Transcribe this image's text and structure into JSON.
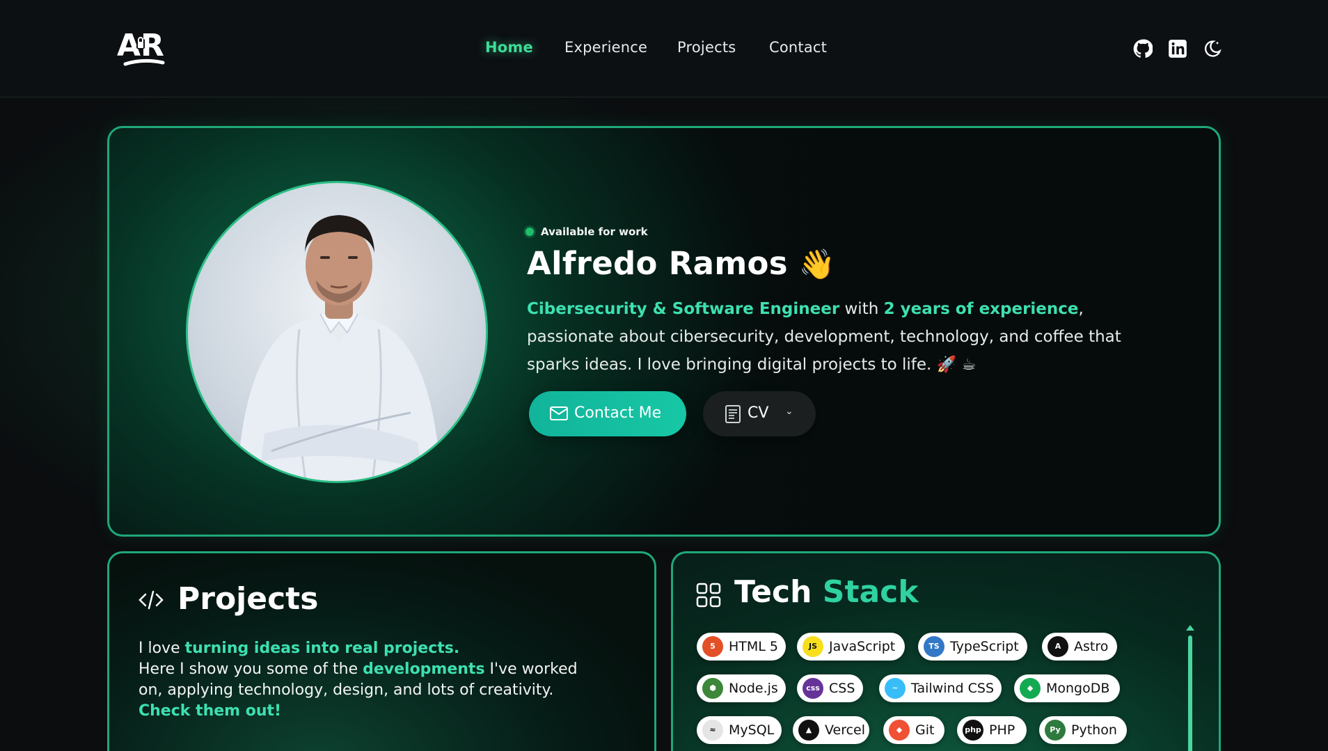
{
  "brand": {
    "logo_text": "AR"
  },
  "nav": {
    "items": [
      {
        "label": "Home",
        "active": true
      },
      {
        "label": "Experience",
        "active": false
      },
      {
        "label": "Projects",
        "active": false
      },
      {
        "label": "Contact",
        "active": false
      }
    ]
  },
  "header_icons": [
    "github-icon",
    "linkedin-icon",
    "theme-toggle-icon"
  ],
  "hero": {
    "status": "Available for work",
    "name": "Alfredo Ramos",
    "name_emoji": "👋",
    "desc_role": "Cibersecurity & Software Engineer",
    "desc_with": " with ",
    "desc_years": "2 years of experience",
    "desc_rest": ", passionate about cibersecurity, development, technology, and coffee that sparks ideas. I love bringing digital projects to life. 🚀 ☕",
    "contact_label": "Contact Me",
    "cv_label": "CV"
  },
  "projects": {
    "title": "Projects",
    "line1_pre": "I love ",
    "line1_hl": "turning ideas into real projects.",
    "line2_pre": "Here I show you some of the ",
    "line2_hl": "developments",
    "line2_post": " I've worked on, applying technology, design, and lots of creativity. ",
    "line2_end": "Check them out!"
  },
  "tech": {
    "title_white": "Tech",
    "title_green": "Stack",
    "chips": [
      {
        "label": "HTML 5",
        "badge": "5",
        "color": "#e34f26"
      },
      {
        "label": "JavaScript",
        "badge": "JS",
        "color": "#f7df1e"
      },
      {
        "label": "TypeScript",
        "badge": "TS",
        "color": "#3178c6"
      },
      {
        "label": "Astro",
        "badge": "A",
        "color": "#111111"
      },
      {
        "label": "Node.js",
        "badge": "⬢",
        "color": "#3c873a"
      },
      {
        "label": "CSS",
        "badge": "css",
        "color": "#663399"
      },
      {
        "label": "Tailwind CSS",
        "badge": "~",
        "color": "#38bdf8"
      },
      {
        "label": "MongoDB",
        "badge": "◆",
        "color": "#13aa52"
      },
      {
        "label": "MySQL",
        "badge": "≈",
        "color": "#e5e5e5"
      },
      {
        "label": "Vercel",
        "badge": "▲",
        "color": "#111111"
      },
      {
        "label": "Git",
        "badge": "◆",
        "color": "#f05033"
      },
      {
        "label": "PHP",
        "badge": "php",
        "color": "#111111"
      },
      {
        "label": "Python",
        "badge": "Py",
        "color": "#2f7a3e"
      }
    ]
  },
  "colors": {
    "accent": "#3ddc97",
    "teal": "#17c7a5",
    "border": "#1fa878"
  }
}
